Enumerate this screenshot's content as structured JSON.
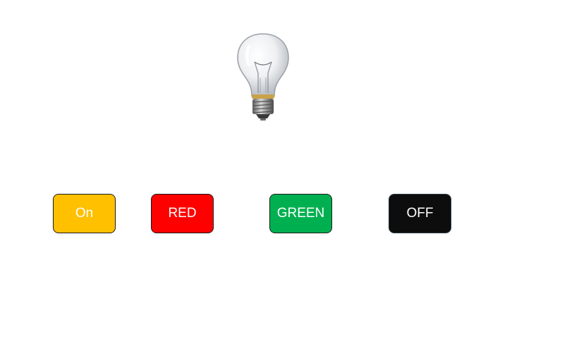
{
  "bulb": {
    "icon": "light-bulb-icon",
    "state": "off"
  },
  "buttons": [
    {
      "id": "on",
      "label": "On",
      "color": "#FFC000"
    },
    {
      "id": "red",
      "label": "RED",
      "color": "#FF0000"
    },
    {
      "id": "green",
      "label": "GREEN",
      "color": "#00B050"
    },
    {
      "id": "off",
      "label": "OFF",
      "color": "#0D0D0D"
    }
  ]
}
